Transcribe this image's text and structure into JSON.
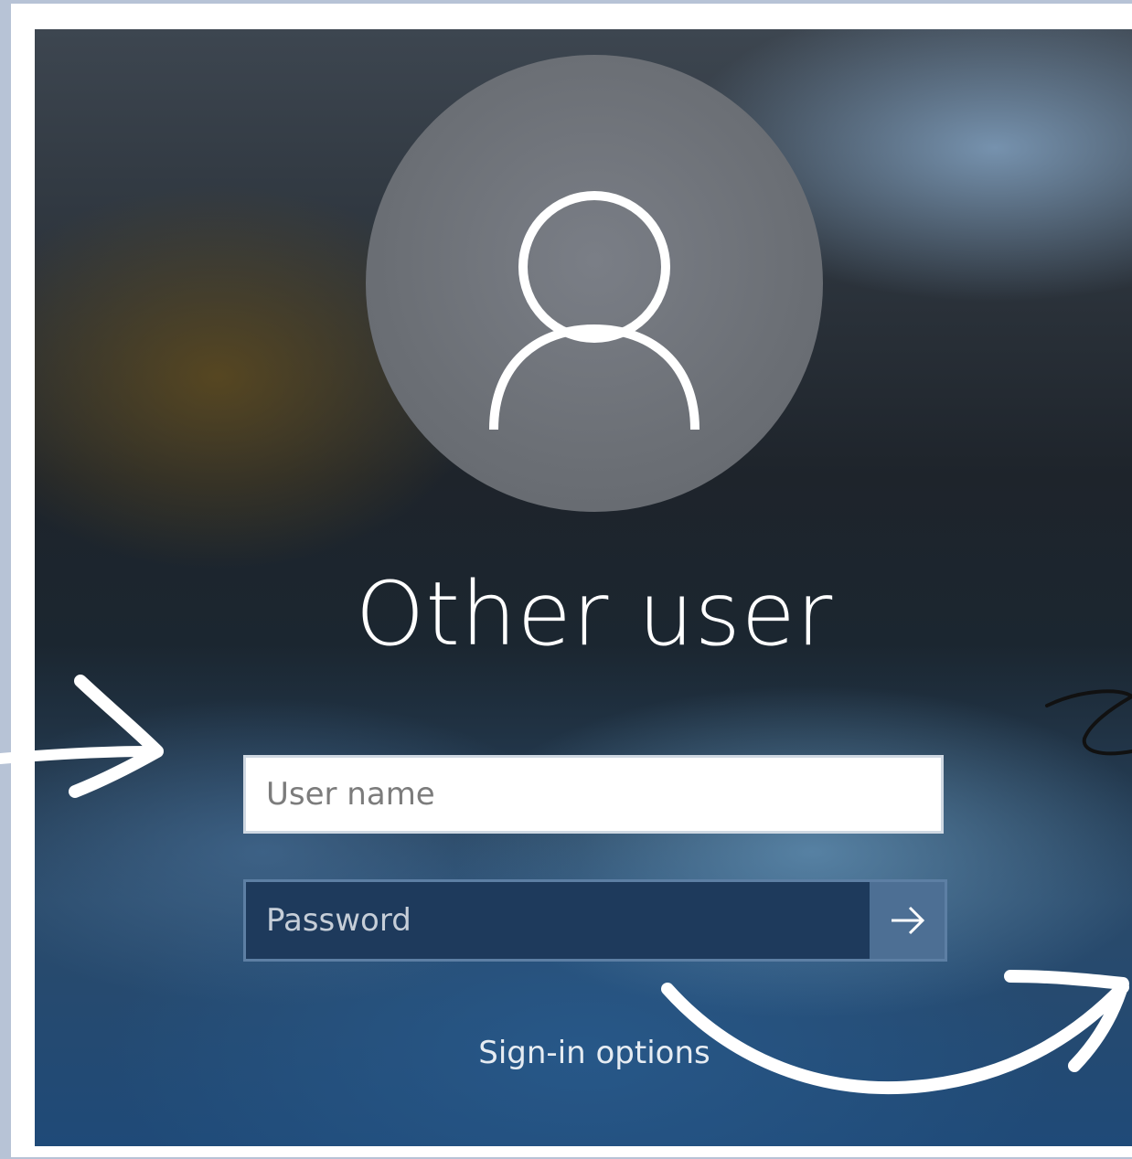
{
  "screen": {
    "title": "Other user",
    "username": {
      "placeholder": "User name",
      "value": ""
    },
    "password": {
      "placeholder": "Password",
      "value": ""
    },
    "submit_icon": "arrow-right-icon",
    "sign_in_options_label": "Sign-in options",
    "avatar_icon": "user-silhouette-icon"
  },
  "annotations": {
    "arrow_to_username": "arrow-annotation",
    "arrow_to_submit": "curved-arrow-annotation",
    "scribble": "scribble-annotation"
  }
}
